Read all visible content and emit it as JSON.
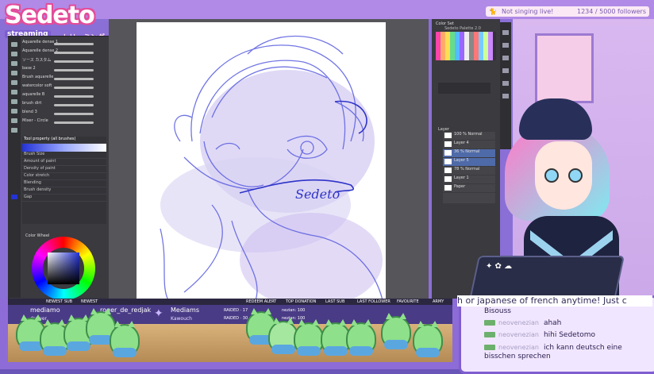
{
  "overlay": {
    "logo": "Sedeto",
    "logo_sub": "streaming",
    "logo_jp": "トリーミング",
    "now_playing": "Not singing live!",
    "follower_count": "1234 / 5000 followers"
  },
  "left_panel": {
    "brushes": [
      "Aquarelle dense 1",
      "Aquarelle dense 2",
      "ソース カスタム",
      "base 2",
      "Brush aquarelle",
      "watercolor soft",
      "aquarelle B",
      "brush dirt",
      "blend 3",
      "Mixer - Circle"
    ],
    "subtool_title": "Tool property (all brushes)",
    "subtool_rows": [
      "Brush Size",
      "Amount of paint",
      "Density of paint",
      "Color stretch",
      "Blending",
      "Brush density",
      "Gap"
    ],
    "color_panel_title": "Color Wheel"
  },
  "right_panel": {
    "palette_title": "Color Set",
    "palette_name": "Sedeto Palette 2.0",
    "layer_title": "Layer",
    "layers": [
      {
        "name": "100 % Normal",
        "selected": false
      },
      {
        "name": "Layer 4",
        "selected": false
      },
      {
        "name": "36 % Normal",
        "selected": true
      },
      {
        "name": "Layer 5",
        "selected": true
      },
      {
        "name": "78 % Normal",
        "selected": false
      },
      {
        "name": "Layer 1",
        "selected": false
      },
      {
        "name": "Paper",
        "selected": false
      }
    ]
  },
  "canvas": {
    "signature": "Sedeto"
  },
  "bottom_bar": {
    "ticker": [
      "NEWEST SUB",
      "NEWEST",
      "REDEEM ALERT",
      "TOP DONATION",
      "LAST SUB",
      "LAST FOLLOWER",
      "FAVOURITE",
      "ARMY"
    ],
    "alerts": [
      {
        "name": "mediamo",
        "sub": "drawer"
      },
      {
        "name": "roger_de_redjak",
        "sub": "oryl"
      },
      {
        "name": "Mediams",
        "sub": "Kawouch"
      }
    ],
    "raids": [
      {
        "label": "RAIDED · 17",
        "value": "nezian: 100"
      },
      {
        "label": "RAIDED · 30",
        "value": "nezian: 100"
      }
    ]
  },
  "chat": {
    "marquee": "h or japanese of french anytime! Just c",
    "messages": [
      {
        "user": "...",
        "text": "Bisouss"
      },
      {
        "user": "neovenezian",
        "text": "ahah"
      },
      {
        "user": "neovenezian",
        "text": "hihi Sedetomo"
      },
      {
        "user": "neovenezian",
        "text": "ich kann deutsch eine bisschen sprechen"
      }
    ]
  },
  "colors": {
    "frame": "#8a6fd6",
    "accent_pink": "#e44d9a",
    "app_dark": "#3a3a3f",
    "sketch_blue": "#5a5ee0"
  }
}
